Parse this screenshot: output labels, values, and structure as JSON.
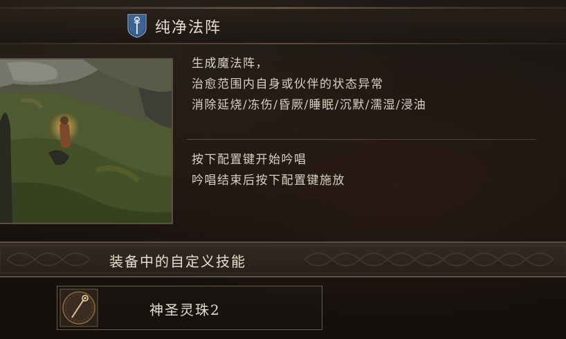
{
  "spell": {
    "name": "纯净法阵",
    "icon": "incantation-staff-icon"
  },
  "description": {
    "lines": [
      "生成魔法阵，",
      "治愈范围内自身或伙伴的状态异常",
      "消除延烧/冻伤/昏厥/睡眠/沉默/濡湿/浸油"
    ]
  },
  "instructions": {
    "lines": [
      "按下配置键开始吟唱",
      "吟唱结束后按下配置键施放"
    ]
  },
  "equipped_section": {
    "title": "装备中的自定义技能",
    "item": {
      "name": "神圣灵珠2",
      "icon": "holy-orb-staff-icon"
    }
  },
  "colors": {
    "text": "#e6dfcf",
    "body_text": "#d8d2c2",
    "border": "#5c5040",
    "background": "#1c1612"
  }
}
